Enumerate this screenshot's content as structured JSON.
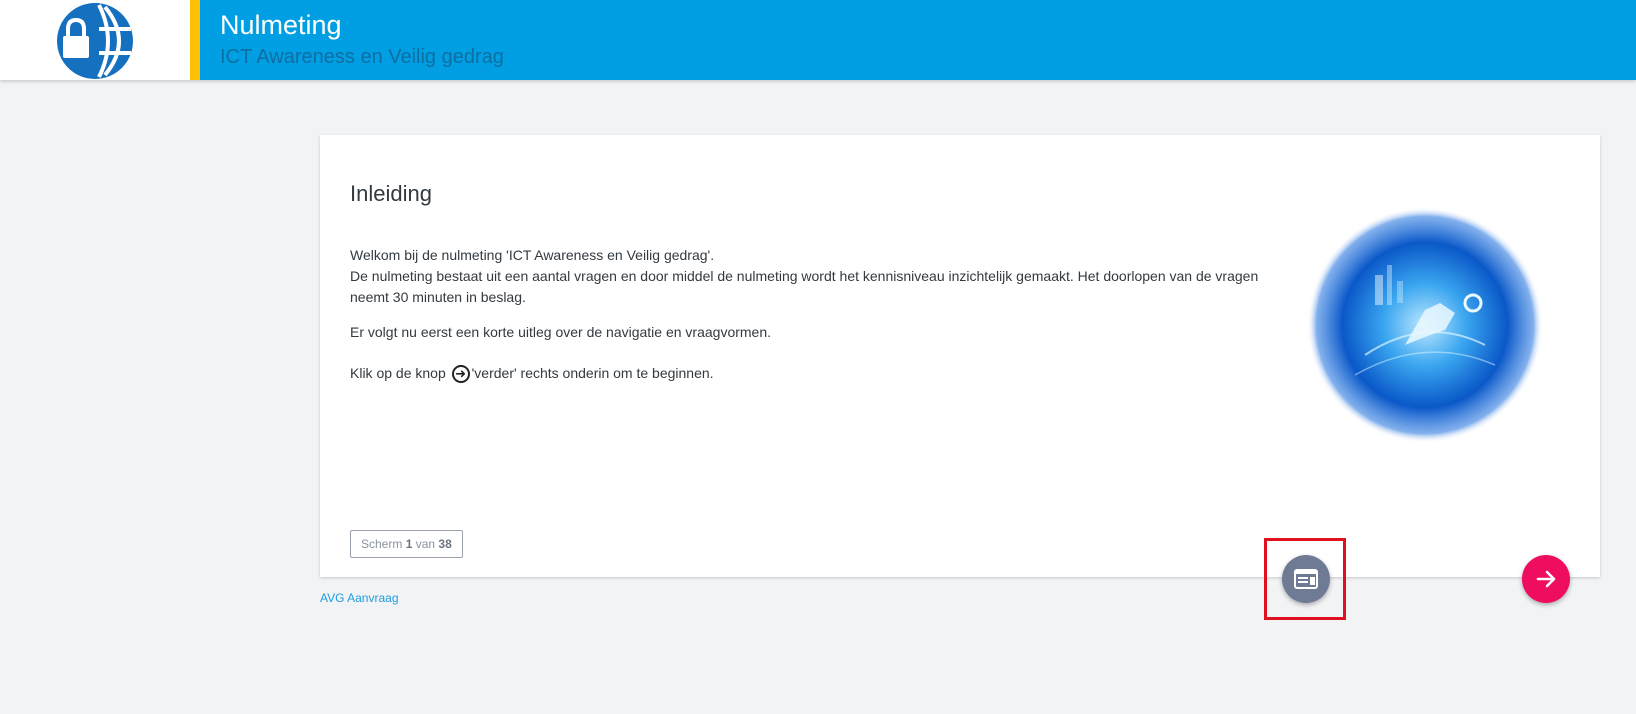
{
  "header": {
    "title": "Nulmeting",
    "subtitle": "ICT Awareness en Veilig gedrag",
    "logo_icon": "globe-lock-icon",
    "brand_color": "#009fe3",
    "accent_color": "#ffc107"
  },
  "card": {
    "title": "Inleiding",
    "paragraph1_line1": "Welkom bij de nulmeting 'ICT Awareness en Veilig gedrag'.",
    "paragraph1_line2": "De nulmeting bestaat uit een aantal vragen en door middel de nulmeting wordt het kennisniveau inzichtelijk gemaakt. Het doorlopen van de vragen neemt 30 minuten in beslag.",
    "paragraph2": "Er volgt nu eerst een korte uitleg over de navigatie en vraagvormen.",
    "paragraph3_before": "Klik op de knop",
    "paragraph3_after": "'verder' rechts onderin om te beginnen.",
    "inline_icon": "arrow-right-circle-icon",
    "hero_image": "digital-hand-globe-image"
  },
  "pager": {
    "prefix": "Scherm",
    "current": "1",
    "middle": "van",
    "total": "38"
  },
  "footer": {
    "avg_link": "AVG Aanvraag"
  },
  "actions": {
    "menu_icon": "screen-menu-icon",
    "next_icon": "arrow-right-icon",
    "next_color": "#ef0d5f",
    "highlight_color": "#e0101e"
  }
}
